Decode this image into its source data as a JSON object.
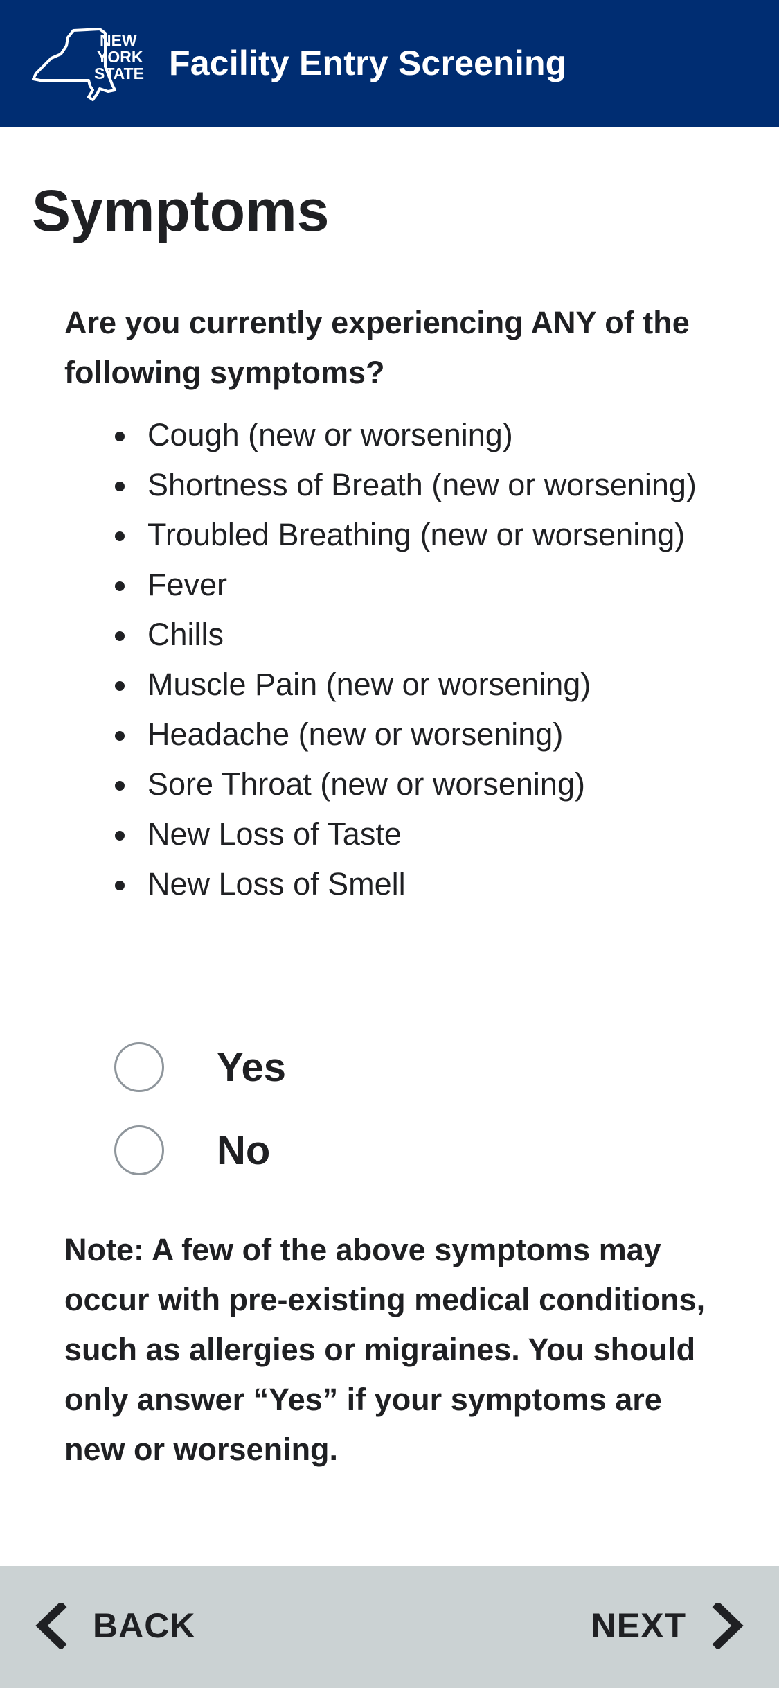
{
  "header": {
    "logo": {
      "line1": "NEW",
      "line2": "YORK",
      "line3": "STATE"
    },
    "title": "Facility Entry Screening",
    "background_color": "#002d72"
  },
  "page_title": "Symptoms",
  "question": "Are you currently experiencing ANY of the following symptoms?",
  "symptoms": [
    "Cough (new or worsening)",
    "Shortness of Breath (new or worsening)",
    "Troubled Breathing (new or worsening)",
    "Fever",
    "Chills",
    "Muscle Pain (new or worsening)",
    "Headache (new or worsening)",
    "Sore Throat (new or worsening)",
    "New Loss of Taste",
    "New Loss of Smell"
  ],
  "options": {
    "yes": "Yes",
    "no": "No",
    "selected": null
  },
  "note": "Note: A few of the above symptoms may occur with pre-existing medical conditions, such as allergies or migraines. You should only answer “Yes” if your symptoms are new or worsening.",
  "footer": {
    "back_label": "BACK",
    "next_label": "NEXT",
    "back_icon": "chevron-left-icon",
    "next_icon": "chevron-right-icon",
    "background_color": "#cbd2d3"
  }
}
